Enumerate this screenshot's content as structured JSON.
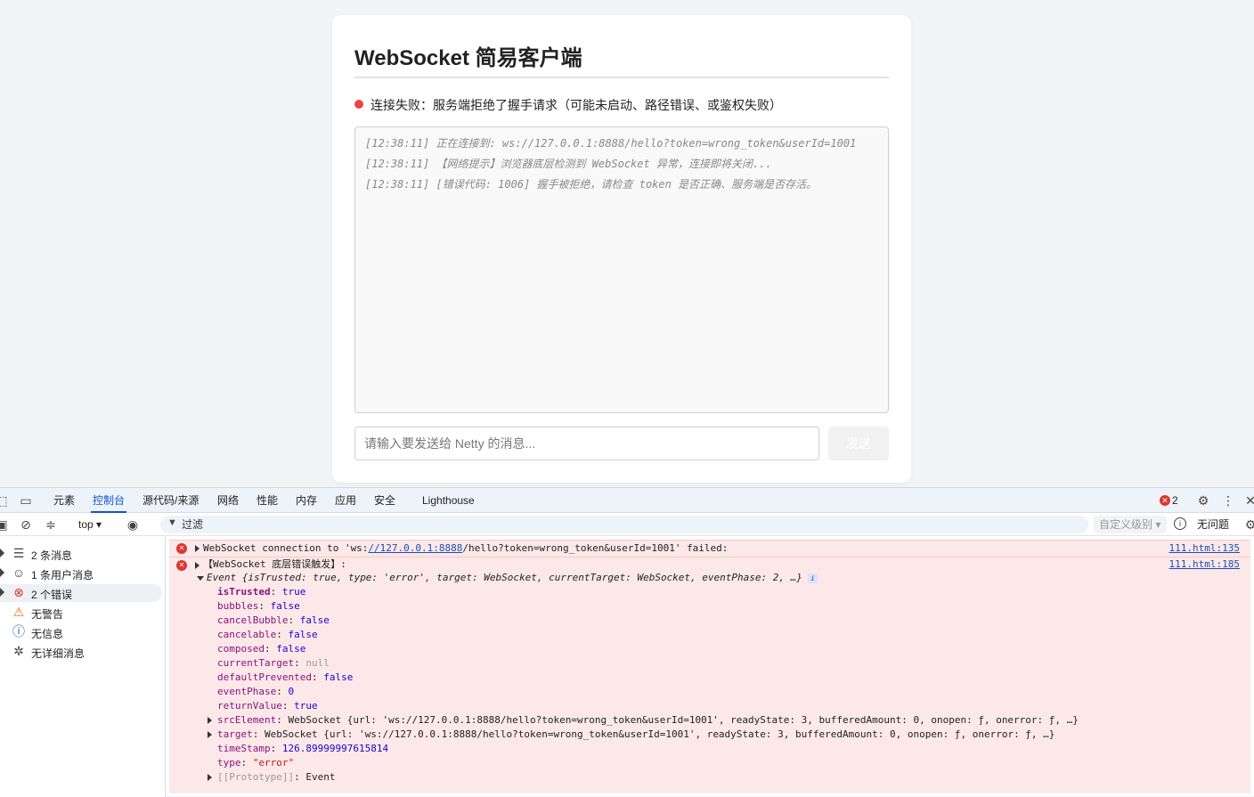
{
  "page": {
    "title": "WebSocket 简易客户端",
    "status_text": "连接失败：服务端拒绝了握手请求（可能未启动、路径错误、或鉴权失败）",
    "status_color": "#ef4444",
    "log": [
      "[12:38:11] 正在连接到: ws://127.0.0.1:8888/hello?token=wrong_token&userId=1001",
      "[12:38:11] 【网络提示】浏览器底层检测到 WebSocket 异常，连接即将关闭...",
      "[12:38:11] [错误代码: 1006] 握手被拒绝，请检查 token 是否正确、服务端是否存活。"
    ],
    "input_placeholder": "请输入要发送给 Netty 的消息...",
    "send_label": "发送"
  },
  "devtools": {
    "tabs": [
      "元素",
      "控制台",
      "源代码/来源",
      "网络",
      "性能",
      "内存",
      "应用",
      "安全",
      "Lighthouse"
    ],
    "active_tab": "控制台",
    "error_badge": "2",
    "context": "top",
    "filter_placeholder": "过滤",
    "level_label": "自定义级别",
    "issues_label": "无问题",
    "sidebar": [
      {
        "label": "2 条消息",
        "icon": "list-icon",
        "expandable": true
      },
      {
        "label": "1 条用户消息",
        "icon": "user-icon",
        "expandable": true
      },
      {
        "label": "2 个错误",
        "icon": "error-icon",
        "expandable": true,
        "selected": true
      },
      {
        "label": "无警告",
        "icon": "warning-icon",
        "expandable": false
      },
      {
        "label": "无信息",
        "icon": "info-icon",
        "expandable": false
      },
      {
        "label": "无详细消息",
        "icon": "bug-icon",
        "expandable": false
      }
    ],
    "console": {
      "msg1": {
        "prefix": "WebSocket connection to 'ws:",
        "link": "//127.0.0.1:8888",
        "suffix": "/hello?token=wrong_token&userId=1001' failed:",
        "source": "111.html:135"
      },
      "msg2": {
        "header": "【WebSocket 底层错误触发】:",
        "source": "111.html:185",
        "event_summary_head": "Event {",
        "event_summary": "isTrusted: true, type: 'error', target: WebSocket, currentTarget: WebSocket, eventPhase: 2, …}",
        "props": [
          {
            "key": "isTrusted",
            "value": "true",
            "kind": "n",
            "bold": true
          },
          {
            "key": "bubbles",
            "value": "false",
            "kind": "n"
          },
          {
            "key": "cancelBubble",
            "value": "false",
            "kind": "n"
          },
          {
            "key": "cancelable",
            "value": "false",
            "kind": "n"
          },
          {
            "key": "composed",
            "value": "false",
            "kind": "n"
          },
          {
            "key": "currentTarget",
            "value": "null",
            "kind": "nul"
          },
          {
            "key": "defaultPrevented",
            "value": "false",
            "kind": "n"
          },
          {
            "key": "eventPhase",
            "value": "0",
            "kind": "n"
          },
          {
            "key": "returnValue",
            "value": "true",
            "kind": "n"
          }
        ],
        "src_element": {
          "key": "srcElement",
          "value": "WebSocket {url: 'ws://127.0.0.1:8888/hello?token=wrong_token&userId=1001', readyState: 3, bufferedAmount: 0, onopen: ƒ, onerror: ƒ, …}"
        },
        "target": {
          "key": "target",
          "value": "WebSocket {url: 'ws://127.0.0.1:8888/hello?token=wrong_token&userId=1001', readyState: 3, bufferedAmount: 0, onopen: ƒ, onerror: ƒ, …}"
        },
        "timestamp": {
          "key": "timeStamp",
          "value": "126.89999997615814"
        },
        "type": {
          "key": "type",
          "value": "\"error\""
        },
        "prototype": {
          "key": "[[Prototype]]",
          "value": "Event"
        }
      }
    }
  }
}
